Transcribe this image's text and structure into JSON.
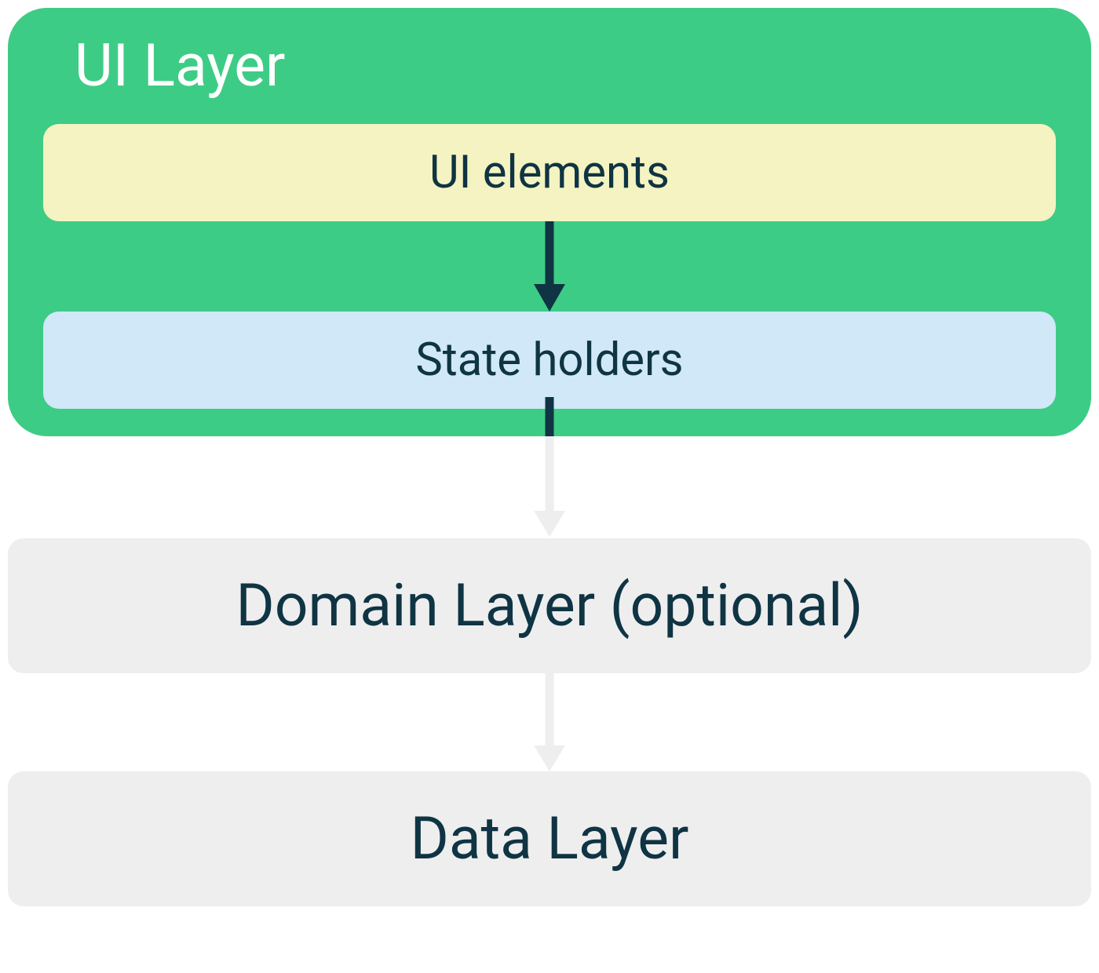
{
  "diagram": {
    "ui_layer": {
      "title": "UI Layer",
      "ui_elements_label": "UI elements",
      "state_holders_label": "State holders"
    },
    "domain_layer_label": "Domain Layer (optional)",
    "data_layer_label": "Data Layer",
    "colors": {
      "ui_layer_bg": "#3DCC85",
      "ui_elements_bg": "#F4F3C1",
      "state_holders_bg": "#D0E8F7",
      "layer_bg": "#EEEEEE",
      "dark_arrow": "#0F3443",
      "light_arrow": "#EEEEEE",
      "text_dark": "#0F3443",
      "text_white": "#FFFFFF"
    },
    "structure": {
      "type": "layered-architecture",
      "layers": [
        "UI Layer",
        "Domain Layer (optional)",
        "Data Layer"
      ],
      "ui_layer_children": [
        "UI elements",
        "State holders"
      ],
      "flow_direction": "top-to-bottom"
    }
  }
}
